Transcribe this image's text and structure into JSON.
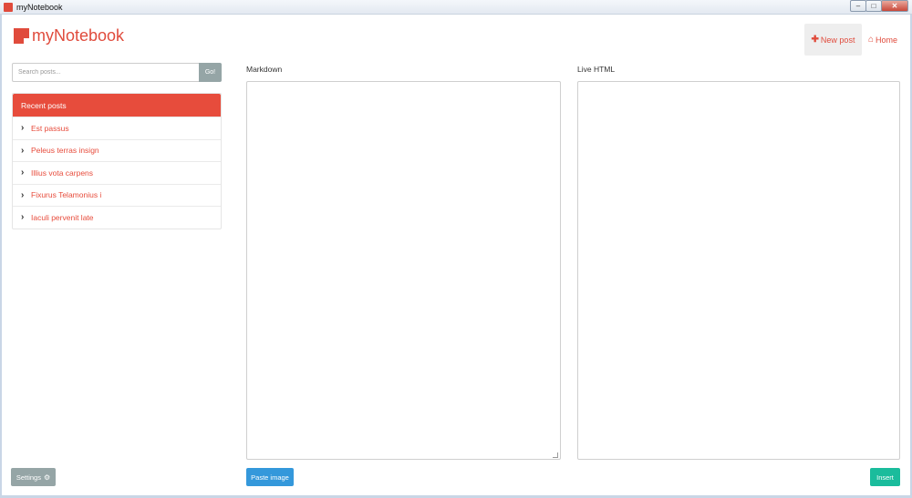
{
  "window": {
    "title": "myNotebook",
    "controls": {
      "minimize": "–",
      "maximize": "□",
      "close": "✕"
    }
  },
  "brand": {
    "name": "myNotebook",
    "color": "#e04b3c"
  },
  "nav": {
    "new_post": "New post",
    "new_post_icon": "plus-icon",
    "home": "Home",
    "home_icon": "home-icon"
  },
  "search": {
    "placeholder": "Search posts...",
    "button": "Go!"
  },
  "recent": {
    "heading": "Recent posts",
    "items": [
      {
        "label": "Est passus"
      },
      {
        "label": "Peleus terras insign"
      },
      {
        "label": "Illius vota carpens"
      },
      {
        "label": "Fixurus Telamonius i"
      },
      {
        "label": "Iaculi pervenit late"
      }
    ]
  },
  "editor": {
    "markdown_label": "Markdown",
    "html_label": "Live HTML"
  },
  "buttons": {
    "settings": "Settings",
    "paste_image": "Paste image",
    "insert": "Insert"
  },
  "colors": {
    "accent": "#e74c3c",
    "muted": "#95a5a6",
    "primary": "#3498db",
    "success": "#1abc9c"
  }
}
